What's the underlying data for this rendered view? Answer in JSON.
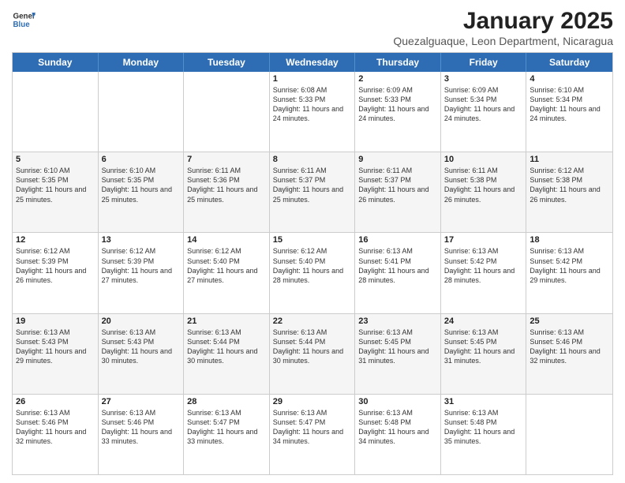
{
  "header": {
    "logo_general": "General",
    "logo_blue": "Blue",
    "month": "January 2025",
    "location": "Quezalguaque, Leon Department, Nicaragua"
  },
  "days_of_week": [
    "Sunday",
    "Monday",
    "Tuesday",
    "Wednesday",
    "Thursday",
    "Friday",
    "Saturday"
  ],
  "weeks": [
    [
      {
        "day": "",
        "sunrise": "",
        "sunset": "",
        "daylight": ""
      },
      {
        "day": "",
        "sunrise": "",
        "sunset": "",
        "daylight": ""
      },
      {
        "day": "",
        "sunrise": "",
        "sunset": "",
        "daylight": ""
      },
      {
        "day": "1",
        "sunrise": "Sunrise: 6:08 AM",
        "sunset": "Sunset: 5:33 PM",
        "daylight": "Daylight: 11 hours and 24 minutes."
      },
      {
        "day": "2",
        "sunrise": "Sunrise: 6:09 AM",
        "sunset": "Sunset: 5:33 PM",
        "daylight": "Daylight: 11 hours and 24 minutes."
      },
      {
        "day": "3",
        "sunrise": "Sunrise: 6:09 AM",
        "sunset": "Sunset: 5:34 PM",
        "daylight": "Daylight: 11 hours and 24 minutes."
      },
      {
        "day": "4",
        "sunrise": "Sunrise: 6:10 AM",
        "sunset": "Sunset: 5:34 PM",
        "daylight": "Daylight: 11 hours and 24 minutes."
      }
    ],
    [
      {
        "day": "5",
        "sunrise": "Sunrise: 6:10 AM",
        "sunset": "Sunset: 5:35 PM",
        "daylight": "Daylight: 11 hours and 25 minutes."
      },
      {
        "day": "6",
        "sunrise": "Sunrise: 6:10 AM",
        "sunset": "Sunset: 5:35 PM",
        "daylight": "Daylight: 11 hours and 25 minutes."
      },
      {
        "day": "7",
        "sunrise": "Sunrise: 6:11 AM",
        "sunset": "Sunset: 5:36 PM",
        "daylight": "Daylight: 11 hours and 25 minutes."
      },
      {
        "day": "8",
        "sunrise": "Sunrise: 6:11 AM",
        "sunset": "Sunset: 5:37 PM",
        "daylight": "Daylight: 11 hours and 25 minutes."
      },
      {
        "day": "9",
        "sunrise": "Sunrise: 6:11 AM",
        "sunset": "Sunset: 5:37 PM",
        "daylight": "Daylight: 11 hours and 26 minutes."
      },
      {
        "day": "10",
        "sunrise": "Sunrise: 6:11 AM",
        "sunset": "Sunset: 5:38 PM",
        "daylight": "Daylight: 11 hours and 26 minutes."
      },
      {
        "day": "11",
        "sunrise": "Sunrise: 6:12 AM",
        "sunset": "Sunset: 5:38 PM",
        "daylight": "Daylight: 11 hours and 26 minutes."
      }
    ],
    [
      {
        "day": "12",
        "sunrise": "Sunrise: 6:12 AM",
        "sunset": "Sunset: 5:39 PM",
        "daylight": "Daylight: 11 hours and 26 minutes."
      },
      {
        "day": "13",
        "sunrise": "Sunrise: 6:12 AM",
        "sunset": "Sunset: 5:39 PM",
        "daylight": "Daylight: 11 hours and 27 minutes."
      },
      {
        "day": "14",
        "sunrise": "Sunrise: 6:12 AM",
        "sunset": "Sunset: 5:40 PM",
        "daylight": "Daylight: 11 hours and 27 minutes."
      },
      {
        "day": "15",
        "sunrise": "Sunrise: 6:12 AM",
        "sunset": "Sunset: 5:40 PM",
        "daylight": "Daylight: 11 hours and 28 minutes."
      },
      {
        "day": "16",
        "sunrise": "Sunrise: 6:13 AM",
        "sunset": "Sunset: 5:41 PM",
        "daylight": "Daylight: 11 hours and 28 minutes."
      },
      {
        "day": "17",
        "sunrise": "Sunrise: 6:13 AM",
        "sunset": "Sunset: 5:42 PM",
        "daylight": "Daylight: 11 hours and 28 minutes."
      },
      {
        "day": "18",
        "sunrise": "Sunrise: 6:13 AM",
        "sunset": "Sunset: 5:42 PM",
        "daylight": "Daylight: 11 hours and 29 minutes."
      }
    ],
    [
      {
        "day": "19",
        "sunrise": "Sunrise: 6:13 AM",
        "sunset": "Sunset: 5:43 PM",
        "daylight": "Daylight: 11 hours and 29 minutes."
      },
      {
        "day": "20",
        "sunrise": "Sunrise: 6:13 AM",
        "sunset": "Sunset: 5:43 PM",
        "daylight": "Daylight: 11 hours and 30 minutes."
      },
      {
        "day": "21",
        "sunrise": "Sunrise: 6:13 AM",
        "sunset": "Sunset: 5:44 PM",
        "daylight": "Daylight: 11 hours and 30 minutes."
      },
      {
        "day": "22",
        "sunrise": "Sunrise: 6:13 AM",
        "sunset": "Sunset: 5:44 PM",
        "daylight": "Daylight: 11 hours and 30 minutes."
      },
      {
        "day": "23",
        "sunrise": "Sunrise: 6:13 AM",
        "sunset": "Sunset: 5:45 PM",
        "daylight": "Daylight: 11 hours and 31 minutes."
      },
      {
        "day": "24",
        "sunrise": "Sunrise: 6:13 AM",
        "sunset": "Sunset: 5:45 PM",
        "daylight": "Daylight: 11 hours and 31 minutes."
      },
      {
        "day": "25",
        "sunrise": "Sunrise: 6:13 AM",
        "sunset": "Sunset: 5:46 PM",
        "daylight": "Daylight: 11 hours and 32 minutes."
      }
    ],
    [
      {
        "day": "26",
        "sunrise": "Sunrise: 6:13 AM",
        "sunset": "Sunset: 5:46 PM",
        "daylight": "Daylight: 11 hours and 32 minutes."
      },
      {
        "day": "27",
        "sunrise": "Sunrise: 6:13 AM",
        "sunset": "Sunset: 5:46 PM",
        "daylight": "Daylight: 11 hours and 33 minutes."
      },
      {
        "day": "28",
        "sunrise": "Sunrise: 6:13 AM",
        "sunset": "Sunset: 5:47 PM",
        "daylight": "Daylight: 11 hours and 33 minutes."
      },
      {
        "day": "29",
        "sunrise": "Sunrise: 6:13 AM",
        "sunset": "Sunset: 5:47 PM",
        "daylight": "Daylight: 11 hours and 34 minutes."
      },
      {
        "day": "30",
        "sunrise": "Sunrise: 6:13 AM",
        "sunset": "Sunset: 5:48 PM",
        "daylight": "Daylight: 11 hours and 34 minutes."
      },
      {
        "day": "31",
        "sunrise": "Sunrise: 6:13 AM",
        "sunset": "Sunset: 5:48 PM",
        "daylight": "Daylight: 11 hours and 35 minutes."
      },
      {
        "day": "",
        "sunrise": "",
        "sunset": "",
        "daylight": ""
      }
    ]
  ]
}
